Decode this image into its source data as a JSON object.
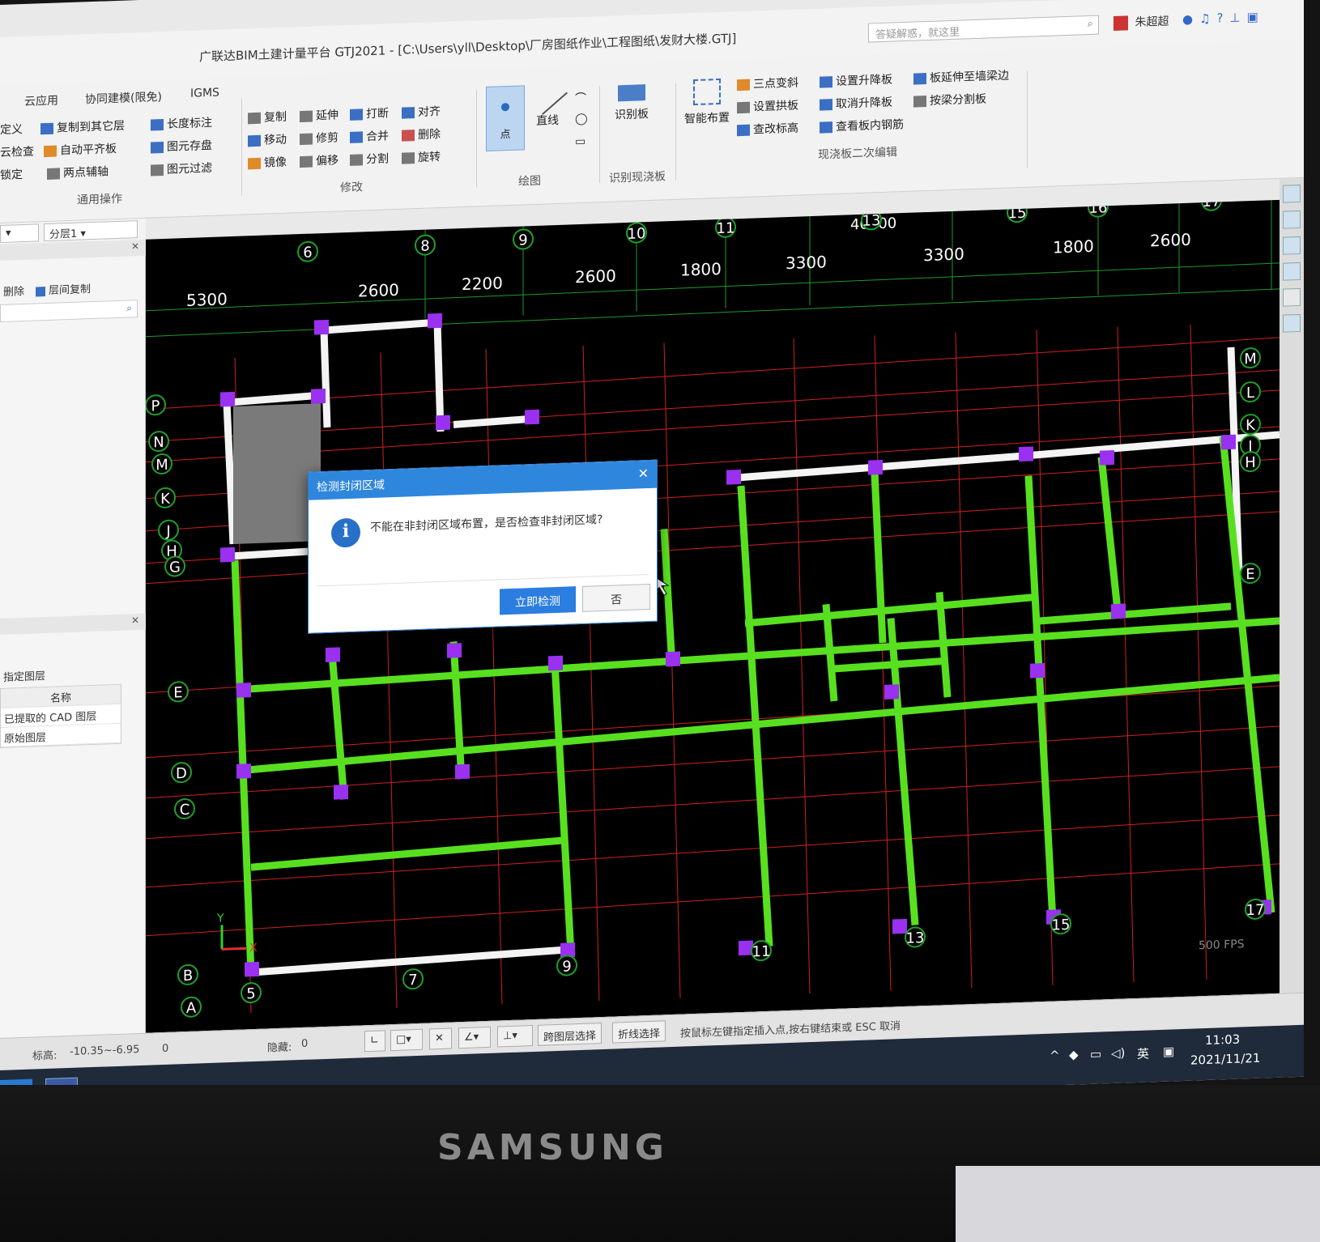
{
  "window": {
    "title": "广联达BIM土建计量平台 GTJ2021 - [C:\\Users\\yll\\Desktop\\厂房图纸作业\\工程图纸\\发财大楼.GTJ]",
    "search_placeholder": "答疑解惑，就这里",
    "user_name": "朱超超",
    "minimize": "–",
    "restore": "▫",
    "close": "✕"
  },
  "ribbon": {
    "tabs": [
      "云应用",
      "协同建模(限免)",
      "IGMS"
    ],
    "general_ops": {
      "items": [
        "定义",
        "复制到其它层",
        "长度标注",
        "云检查",
        "自动平齐板",
        "图元存盘",
        "锁定",
        "两点辅轴",
        "图元过滤"
      ],
      "group_label": "通用操作"
    },
    "modify": {
      "items": [
        "复制",
        "延伸",
        "打断",
        "对齐",
        "移动",
        "修剪",
        "合并",
        "删除",
        "镜像",
        "偏移",
        "分割",
        "旋转"
      ],
      "group_label": "修改"
    },
    "draw": {
      "items": [
        "点",
        "直线"
      ],
      "group_label": "绘图"
    },
    "identify": {
      "items": [
        "识别板"
      ],
      "group_label": "识别现浇板"
    },
    "slab_edit": {
      "items": [
        "智能布置",
        "三点变斜",
        "设置升降板",
        "板延伸至墙梁边",
        "设置拱板",
        "取消升降板",
        "按梁分割板",
        "查改标高",
        "查看板内钢筋"
      ],
      "group_label": "现浇板二次编辑"
    }
  },
  "left_panel": {
    "floor_combo": "分层1",
    "copy_actions": [
      "删除",
      "层间复制"
    ],
    "layers_title": "已提取的 CAD 图层",
    "layers_section": "指定图层",
    "layers_header": "名称",
    "layers": [
      "已提取的 CAD 图层",
      "原始图层"
    ]
  },
  "drawing": {
    "top_dims": [
      "5300",
      "2600",
      "2200",
      "2600",
      "1800",
      "3300",
      "3300",
      "1800",
      "2600"
    ],
    "top_overlap_label": "46400",
    "top_axes": [
      "6",
      "8",
      "9",
      "10",
      "11",
      "13",
      "15",
      "16",
      "17"
    ],
    "left_axes": [
      "P",
      "N",
      "M",
      "K",
      "J",
      "H",
      "G",
      "E",
      "D",
      "C",
      "B",
      "A"
    ],
    "right_axes": [
      "M",
      "L",
      "K",
      "J",
      "H",
      "E"
    ],
    "bottom_axes": [
      "5",
      "7",
      "9",
      "11",
      "13",
      "15",
      "17"
    ],
    "fps": "500 FPS",
    "axis_x": "X",
    "axis_y": "Y"
  },
  "dialog": {
    "title": "检测封闭区域",
    "message": "不能在非封闭区域布置，是否检查非封闭区域?",
    "confirm_label": "立即检测",
    "cancel_label": "否",
    "close": "✕"
  },
  "status_bar": {
    "elevation_label": "标高:",
    "elevation_value": "-10.35~-6.95",
    "zero": "0",
    "hidden_label": "隐藏:",
    "hidden_value": "0",
    "cross_layer_select": "跨图层选择",
    "polyline_select": "折线选择",
    "hint": "按鼠标左键指定插入点,按右键结束或 ESC 取消"
  },
  "taskbar": {
    "apps": [
      "T",
      "CAD"
    ],
    "ime": "英",
    "time": "11:03",
    "date": "2021/11/21"
  },
  "monitor": {
    "brand": "SAMSUNG"
  }
}
